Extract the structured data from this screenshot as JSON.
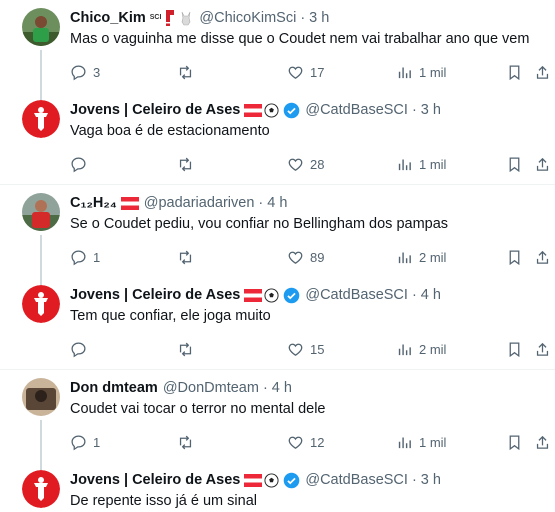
{
  "tweets": [
    {
      "name": "Chico_Kim",
      "handle": "@ChicoKimSci",
      "time": "3 h",
      "emoji": "SCI 🧣 🐐",
      "text": "Mas o vaguinha me disse que o Coudet nem vai trabalhar ano que vem",
      "replies": "3",
      "retweets": "",
      "likes": "17",
      "views": "1 mil",
      "avatar": "player-photo"
    },
    {
      "name": "Jovens | Celeiro de Ases",
      "handle": "@CatdBaseSCI",
      "time": "3 h",
      "emoji": "🇦🇹⚽",
      "text": "Vaga boa é de estacionamento",
      "replies": "",
      "retweets": "",
      "likes": "28",
      "views": "1 mil",
      "avatar": "club-logo"
    },
    {
      "name": "C₁₂H₂₄",
      "handle": "@padariadariven",
      "time": "4 h",
      "emoji": "🇦🇹",
      "text": "Se o Coudet pediu, vou confiar no Bellingham dos pampas",
      "replies": "1",
      "retweets": "",
      "likes": "89",
      "views": "2 mil",
      "avatar": "player-photo"
    },
    {
      "name": "Jovens | Celeiro de Ases",
      "handle": "@CatdBaseSCI",
      "time": "4 h",
      "emoji": "🇦🇹⚽",
      "text": "Tem que confiar, ele joga muito",
      "replies": "",
      "retweets": "",
      "likes": "15",
      "views": "2 mil",
      "avatar": "club-logo"
    },
    {
      "name": "Don dmteam",
      "handle": "@DonDmteam",
      "time": "4 h",
      "emoji": "",
      "text": "Coudet vai tocar o terror no mental dele",
      "replies": "1",
      "retweets": "",
      "likes": "12",
      "views": "1 mil",
      "avatar": "user-photo"
    },
    {
      "name": "Jovens | Celeiro de Ases",
      "handle": "@CatdBaseSCI",
      "time": "3 h",
      "emoji": "🇦🇹⚽",
      "text": "De repente isso já é um sinal",
      "replies": "",
      "retweets": "",
      "likes": "",
      "views": "",
      "avatar": "club-logo"
    }
  ],
  "colors": {
    "club_red": "#e11b22",
    "verified_blue": "#1d9bf0",
    "text_gray": "#536471"
  },
  "icons": [
    "reply-icon",
    "retweet-icon",
    "like-icon",
    "views-icon",
    "bookmark-icon",
    "share-icon",
    "verified-badge-icon"
  ]
}
